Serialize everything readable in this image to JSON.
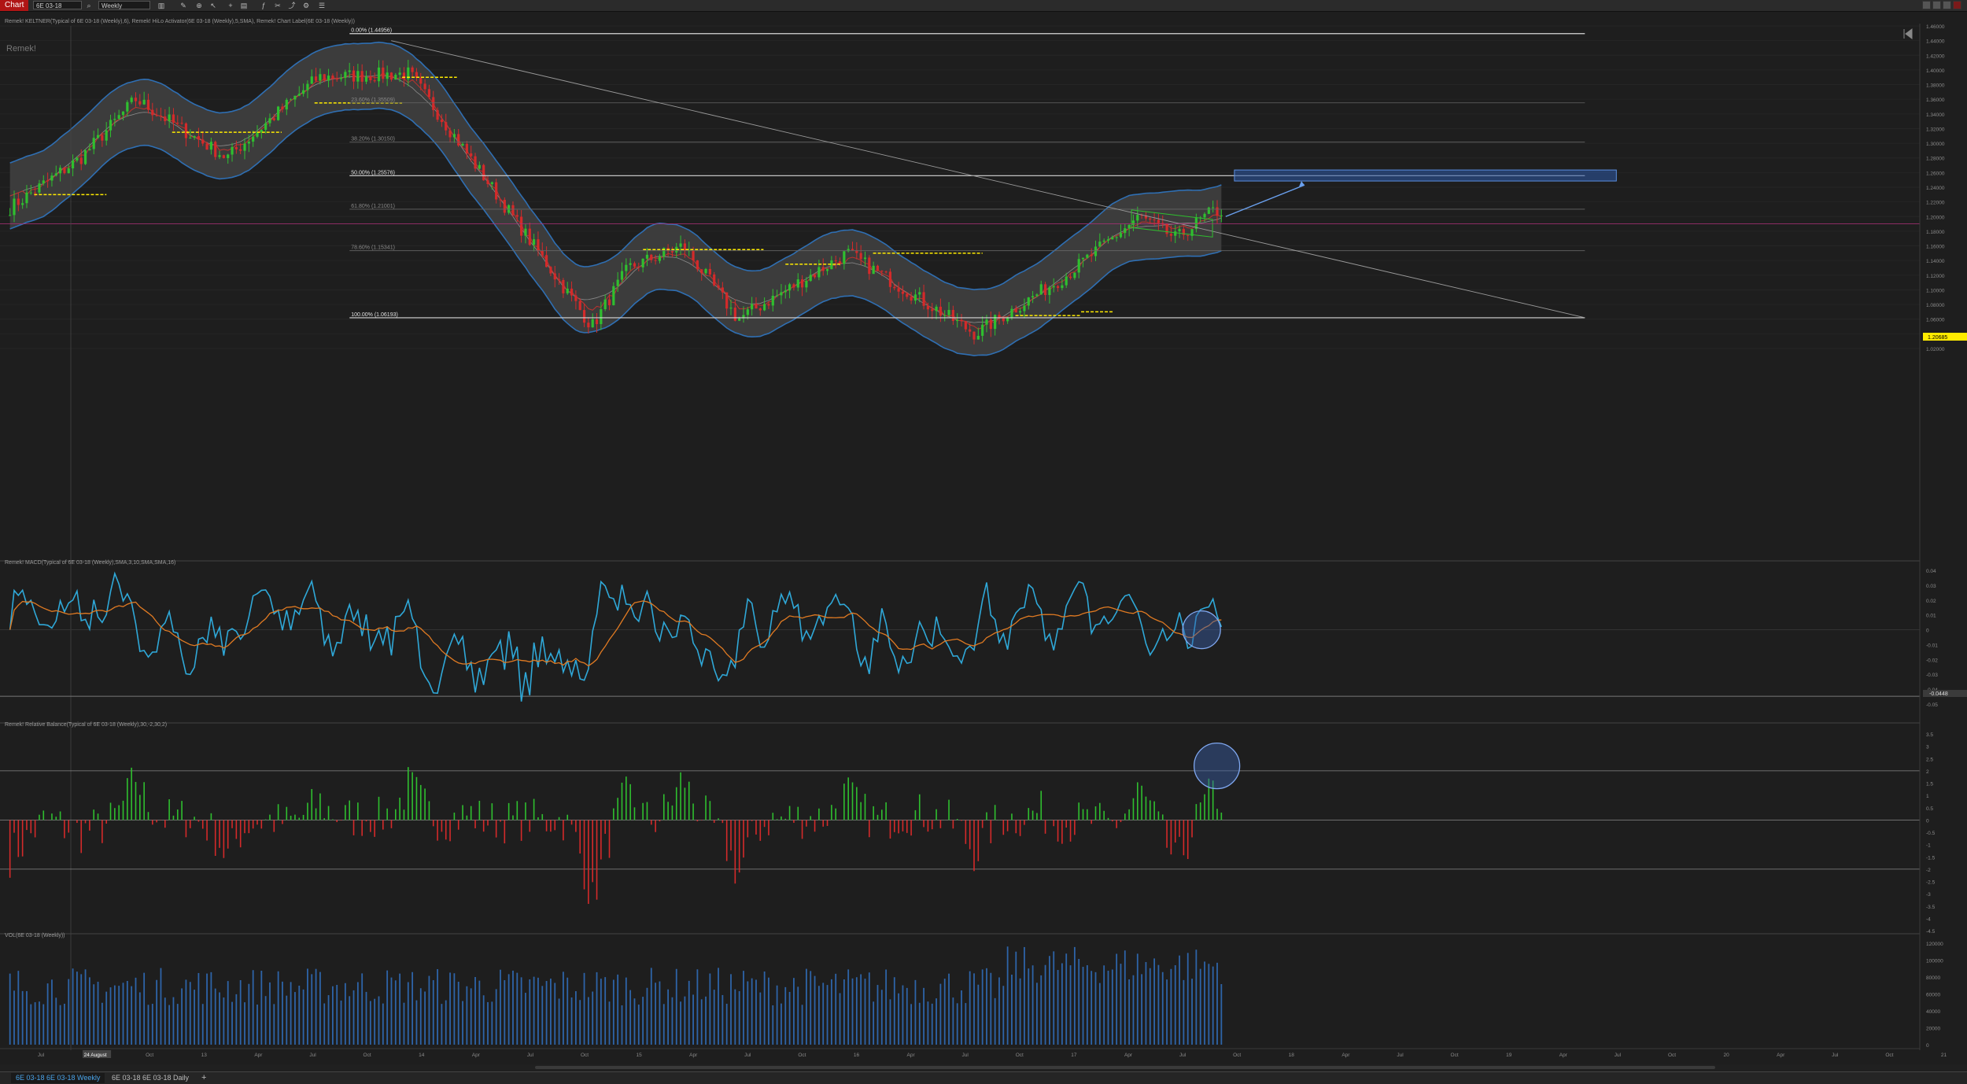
{
  "toolbar": {
    "app_label": "Chart",
    "instrument": "6E 03-18",
    "period": "Weekly",
    "tools": [
      "search-icon",
      "bars-icon",
      "pencil-icon",
      "zoom-icon",
      "cursor-icon",
      "crosshair-icon",
      "fx-icon",
      "properties-icon",
      "share-icon",
      "settings-icon",
      "list-icon"
    ]
  },
  "panels": {
    "price": {
      "title": "Remek! KELTNER(Typical of 6E 03-18 (Weekly),6), Remek! HiLo Activator(6E 03-18 (Weekly),5,SMA), Remek! Chart Label(6E 03-18 (Weekly))",
      "watermark": "Remek!"
    },
    "macd": {
      "title": "Remek! MACD(Typical of 6E 03-18 (Weekly),SMA,3,10,SMA,SMA,16)"
    },
    "balance": {
      "title": "Remek! Relative Balance(Typical of 6E 03-18 (Weekly),30,-2,30,2)"
    },
    "volume": {
      "title": "VOL(6E 03-18 (Weekly))"
    }
  },
  "price_axis": [
    "1.46000",
    "1.44000",
    "1.42000",
    "1.40000",
    "1.38000",
    "1.36000",
    "1.34000",
    "1.32000",
    "1.30000",
    "1.28000",
    "1.26000",
    "1.24000",
    "1.22000",
    "1.20000",
    "1.18000",
    "1.16000",
    "1.14000",
    "1.12000",
    "1.10000",
    "1.08000",
    "1.06000",
    "1.04000",
    "1.02000"
  ],
  "price_marker": "1.20685",
  "macd_axis": [
    "0.04",
    "0.03",
    "0.02",
    "0.01",
    "0",
    "-0.01",
    "-0.02",
    "-0.03",
    "-0.04",
    "-0.05"
  ],
  "macd_marker": "-0.0448",
  "balance_axis": [
    "3.5",
    "3",
    "2.5",
    "2",
    "1.5",
    "1",
    "0.5",
    "0",
    "-0.5",
    "-1",
    "-1.5",
    "-2",
    "-2.5",
    "-3",
    "-3.5",
    "-4",
    "-4.5"
  ],
  "volume_axis": [
    "120000",
    "100000",
    "80000",
    "60000",
    "40000",
    "20000",
    "0"
  ],
  "fib_levels": [
    {
      "label": "0.00% (1.44956)",
      "value": 1.44956
    },
    {
      "label": "23.60% (1.35509)",
      "value": 1.35509
    },
    {
      "label": "38.20% (1.30150)",
      "value": 1.3015
    },
    {
      "label": "50.00% (1.25576)",
      "value": 1.25576
    },
    {
      "label": "61.80% (1.21001)",
      "value": 1.21001
    },
    {
      "label": "78.60% (1.15341)",
      "value": 1.15341
    },
    {
      "label": "100.00% (1.06193)",
      "value": 1.06193
    }
  ],
  "x_axis": {
    "labels": [
      "Jul",
      "24 August",
      "Oct",
      "13",
      "Apr",
      "Jul",
      "Oct",
      "14",
      "Apr",
      "Jul",
      "Oct",
      "15",
      "Apr",
      "Jul",
      "Oct",
      "16",
      "Apr",
      "Jul",
      "Oct",
      "17",
      "Apr",
      "Jul",
      "Oct",
      "18",
      "Apr",
      "Jul",
      "Oct",
      "19",
      "Apr",
      "Jul",
      "Oct",
      "20",
      "Apr",
      "Jul",
      "Oct",
      "21"
    ],
    "highlight": "24 August"
  },
  "chart_data": {
    "type": "candlestick",
    "instrument": "6E 03-18",
    "timeframe": "Weekly",
    "period": "Jul 2012 – Jan 2018",
    "price_ylim": [
      1.02,
      1.46
    ],
    "price_swings": [
      {
        "date": "Jul 2012",
        "price": 1.21
      },
      {
        "date": "Nov 2012",
        "price": 1.28
      },
      {
        "date": "Feb 2013",
        "price": 1.36
      },
      {
        "date": "Jul 2013",
        "price": 1.28
      },
      {
        "date": "Dec 2013",
        "price": 1.39
      },
      {
        "date": "May 2014",
        "price": 1.395
      },
      {
        "date": "Mar 2015",
        "price": 1.05
      },
      {
        "date": "May 2015",
        "price": 1.13
      },
      {
        "date": "Aug 2015",
        "price": 1.16
      },
      {
        "date": "Nov 2015",
        "price": 1.06
      },
      {
        "date": "May 2016",
        "price": 1.15
      },
      {
        "date": "Dec 2016",
        "price": 1.04
      },
      {
        "date": "May 2017",
        "price": 1.12
      },
      {
        "date": "Sep 2017",
        "price": 1.2
      },
      {
        "date": "Nov 2017",
        "price": 1.17
      },
      {
        "date": "Jan 2018",
        "price": 1.20685
      }
    ],
    "macd_ylim": [
      -0.05,
      0.04
    ],
    "balance_ylim": [
      -4.5,
      3.5
    ],
    "volume_ylim": [
      0,
      120000
    ]
  }
}
